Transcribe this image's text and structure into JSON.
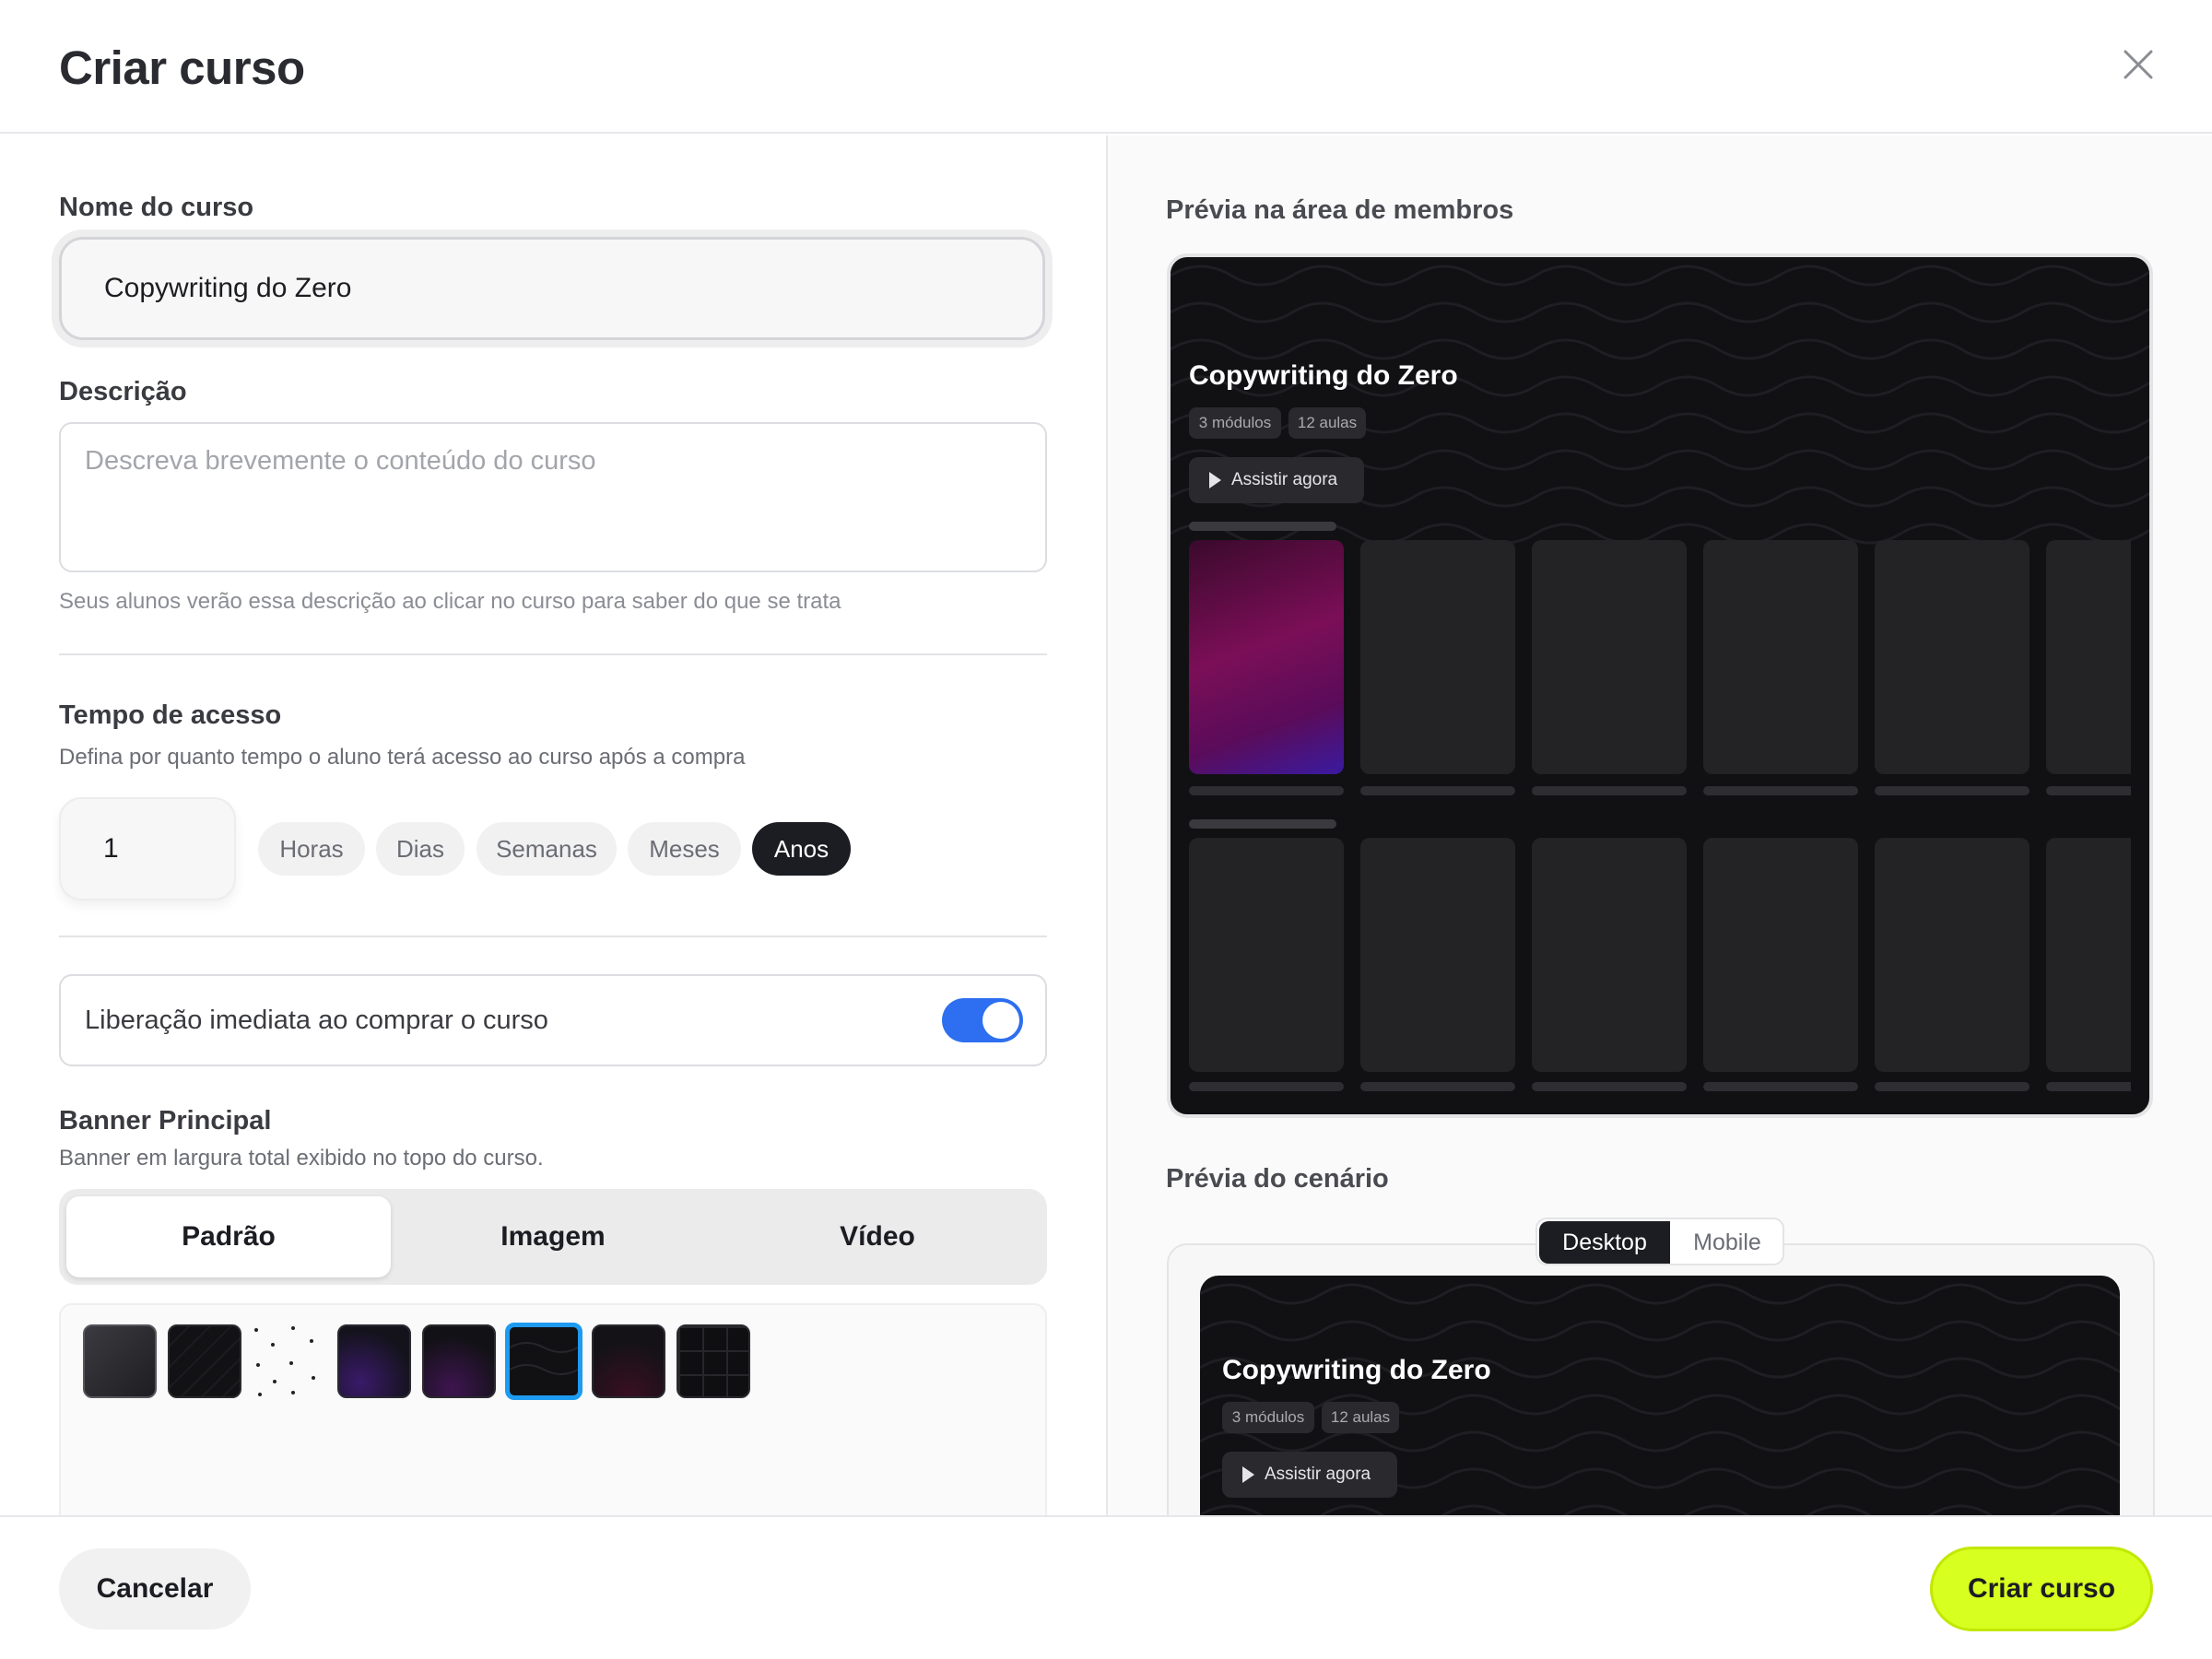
{
  "modal": {
    "title": "Criar curso"
  },
  "form": {
    "name": {
      "label": "Nome do curso",
      "value": "Copywriting do Zero"
    },
    "description": {
      "label": "Descrição",
      "placeholder": "Descreva brevemente o conteúdo do curso",
      "hint": "Seus alunos verão essa descrição ao clicar no curso para saber do que se trata"
    },
    "access": {
      "label": "Tempo de acesso",
      "sublabel": "Defina por quanto tempo o aluno terá acesso ao curso após a compra",
      "amount": "1",
      "units": [
        "Horas",
        "Dias",
        "Semanas",
        "Meses",
        "Anos"
      ],
      "selected_unit": "Anos"
    },
    "immediate_release": {
      "label": "Liberação imediata ao comprar o curso",
      "enabled": true
    },
    "banner": {
      "label": "Banner Principal",
      "sublabel": "Banner em largura total exibido no topo do curso.",
      "tabs": [
        "Padrão",
        "Imagem",
        "Vídeo"
      ],
      "selected_tab": "Padrão",
      "backgrounds": [
        "solid-dark",
        "diagonal-lines",
        "dots",
        "purple-glow",
        "violet-glow",
        "waves",
        "maroon-glow",
        "grid"
      ],
      "selected_background": "waves"
    }
  },
  "preview": {
    "members_label": "Prévia na área de membros",
    "scenario_label": "Prévia do cenário",
    "course_title": "Copywriting do Zero",
    "badges": [
      "3 módulos",
      "12 aulas"
    ],
    "watch_label": "Assistir agora",
    "device_options": [
      "Desktop",
      "Mobile"
    ],
    "selected_device": "Desktop"
  },
  "footer": {
    "cancel_label": "Cancelar",
    "create_label": "Criar curso"
  },
  "colors": {
    "accent": "#d7ff1f",
    "toggle": "#2d6ff0",
    "selected_swatch": "#1e9bf0",
    "dark_chip": "#1c1d22"
  }
}
